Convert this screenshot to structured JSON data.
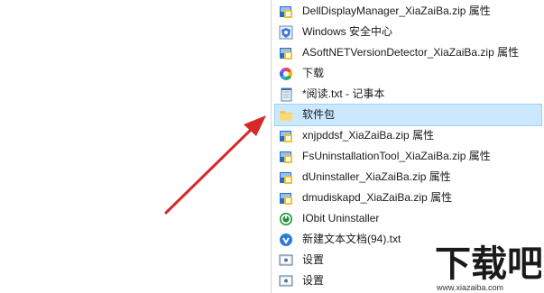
{
  "menu": {
    "items": [
      {
        "label": "DellDisplayManager_XiaZaiBa.zip 属性",
        "icon": "properties-icon"
      },
      {
        "label": "Windows 安全中心",
        "icon": "shield-settings-icon"
      },
      {
        "label": "ASoftNETVersionDetector_XiaZaiBa.zip 属性",
        "icon": "properties-icon"
      },
      {
        "label": "下载",
        "icon": "download-colorful-icon"
      },
      {
        "label": "*阅读.txt - 记事本",
        "icon": "notepad-icon"
      },
      {
        "label": "软件包",
        "icon": "folder-icon"
      },
      {
        "label": "xnjpddsf_XiaZaiBa.zip 属性",
        "icon": "properties-icon"
      },
      {
        "label": "FsUninstallationTool_XiaZaiBa.zip 属性",
        "icon": "properties-icon"
      },
      {
        "label": "dUninstaller_XiaZaiBa.zip 属性",
        "icon": "properties-icon"
      },
      {
        "label": "dmudiskapd_XiaZaiBa.zip 属性",
        "icon": "properties-icon"
      },
      {
        "label": "IObit Uninstaller",
        "icon": "iobit-uninstaller-icon"
      },
      {
        "label": "新建文本文档(94).txt",
        "icon": "text-document-icon"
      },
      {
        "label": "设置",
        "icon": "settings-icon"
      },
      {
        "label": "设置",
        "icon": "settings-icon"
      }
    ],
    "selected_index": 5
  },
  "watermark": {
    "logo_text": "下载吧",
    "url": "www.xiazaiba.com"
  },
  "colors": {
    "selection_bg": "#cce8ff",
    "selection_border": "#99d1ff",
    "arrow": "#d42a2a"
  }
}
